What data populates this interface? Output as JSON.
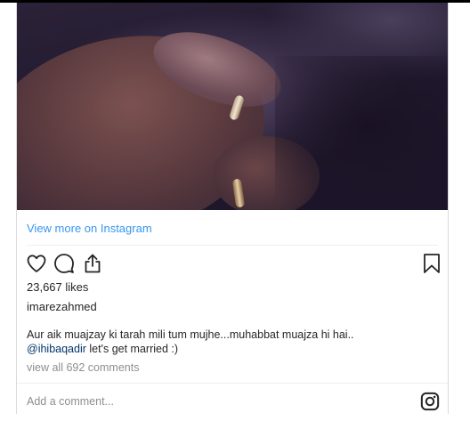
{
  "post": {
    "view_more": "View more on Instagram",
    "likes": "23,667 likes",
    "username": "imarezahmed",
    "caption_text": "Aur aik muajzay ki tarah mili tum mujhe...muhabbat muajza hi hai..",
    "caption_mention": "@ihibaqadir",
    "caption_rest": " let's get married :)",
    "view_all_comments": "view all 692 comments",
    "comment_placeholder": "Add a comment..."
  },
  "icons": {
    "like": "heart-icon",
    "comment": "comment-bubble-icon",
    "share": "share-icon",
    "save": "bookmark-icon",
    "brand": "instagram-icon"
  },
  "colors": {
    "link": "#3897f0",
    "mention": "#003569",
    "muted": "#8e8e8e",
    "text": "#262626"
  }
}
